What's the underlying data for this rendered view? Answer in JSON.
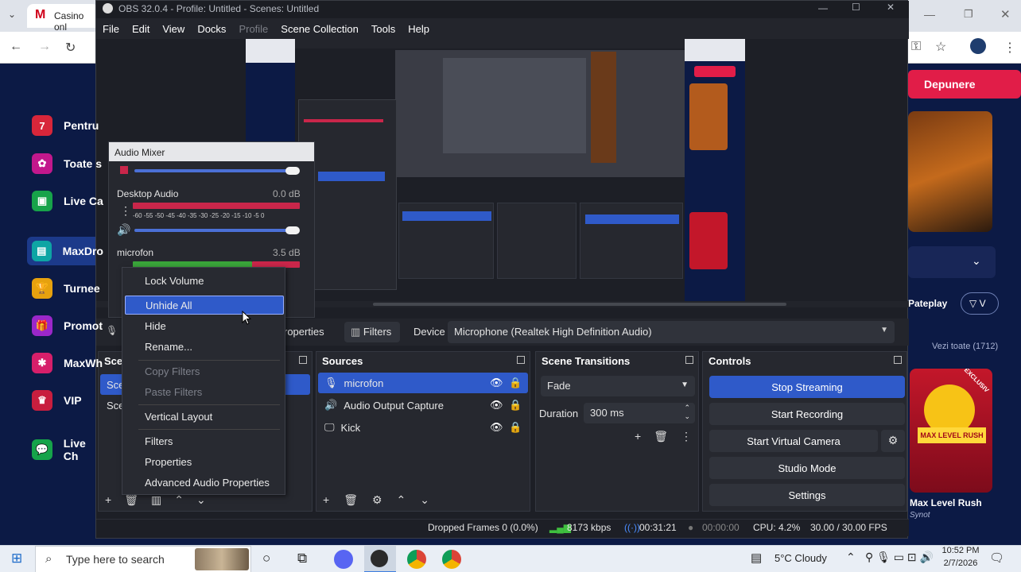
{
  "browser": {
    "tab_title": "Casino onl",
    "tab_icon": "M",
    "sidebar": [
      {
        "label": "Pentru",
        "color": "#d8263a",
        "glyph": "7"
      },
      {
        "label": "Toate s",
        "color": "#c2188c",
        "glyph": "✿"
      },
      {
        "label": "Live Ca",
        "color": "#17a34a",
        "glyph": "▣"
      },
      {
        "label": "MaxDro",
        "color": "#0ea5a4",
        "glyph": "▤"
      },
      {
        "label": "Turnee",
        "color": "#e6a10e",
        "glyph": "🏆"
      },
      {
        "label": "Promot",
        "color": "#9b27c9",
        "glyph": "🎁"
      },
      {
        "label": "MaxWh",
        "color": "#d61f6a",
        "glyph": "✱"
      },
      {
        "label": "VIP",
        "color": "#c81e3e",
        "glyph": "♛"
      },
      {
        "label": "Live Ch",
        "color": "#16a34a",
        "glyph": "💬"
      }
    ],
    "right": {
      "deposit_label": "Depunere",
      "pateplay_label": "Pateplay",
      "see_all": "Vezi toate (1712)",
      "game_title": "Max Level Rush",
      "game_provider": "Synot",
      "badge": "EXCLUSIV",
      "game_art_text": "MAX LEVEL RUSH"
    }
  },
  "obs": {
    "title": "OBS 32.0.4 - Profile: Untitled - Scenes: Untitled",
    "menu": [
      "File",
      "Edit",
      "View",
      "Docks",
      "Profile",
      "Scene Collection",
      "Tools",
      "Help"
    ],
    "source_toolbar": {
      "properties_label": "roperties",
      "filters_label": "Filters",
      "device_label": "Device",
      "device_value": "Microphone (Realtek High Definition Audio)"
    },
    "scenes": {
      "title": "Scen",
      "items": [
        "Scen",
        "Scen"
      ]
    },
    "sources": {
      "title": "Sources",
      "items": [
        {
          "name": "microfon",
          "icon": "mic"
        },
        {
          "name": "Audio Output Capture",
          "icon": "speaker"
        },
        {
          "name": "Kick",
          "icon": "monitor"
        }
      ]
    },
    "transitions": {
      "title": "Scene Transitions",
      "type": "Fade",
      "duration_label": "Duration",
      "duration_value": "300 ms"
    },
    "controls": {
      "title": "Controls",
      "buttons": [
        "Stop Streaming",
        "Start Recording",
        "Start Virtual Camera",
        "Studio Mode",
        "Settings"
      ]
    },
    "status": {
      "dropped": "Dropped Frames 0 (0.0%)",
      "kbps": "8173 kbps",
      "stream_time": "00:31:21",
      "rec_time": "00:00:00",
      "cpu": "CPU: 4.2%",
      "fps": "30.00 / 30.00 FPS"
    },
    "mixer": {
      "title": "Audio Mixer",
      "channels": [
        {
          "name": "Desktop Audio",
          "db": "0.0 dB"
        },
        {
          "name": "microfon",
          "db": "3.5 dB"
        }
      ],
      "scale": "-60 -55 -50 -45 -40 -35 -30 -25 -20 -15 -10 -5 0"
    },
    "context_menu": [
      "Lock Volume",
      "Unhide All",
      "Hide",
      "Rename...",
      "Copy Filters",
      "Paste Filters",
      "Vertical Layout",
      "Filters",
      "Properties",
      "Advanced Audio Properties"
    ]
  },
  "taskbar": {
    "search_placeholder": "Type here to search",
    "weather": "5°C  Cloudy",
    "time": "10:52 PM",
    "date": "2/7/2026"
  }
}
